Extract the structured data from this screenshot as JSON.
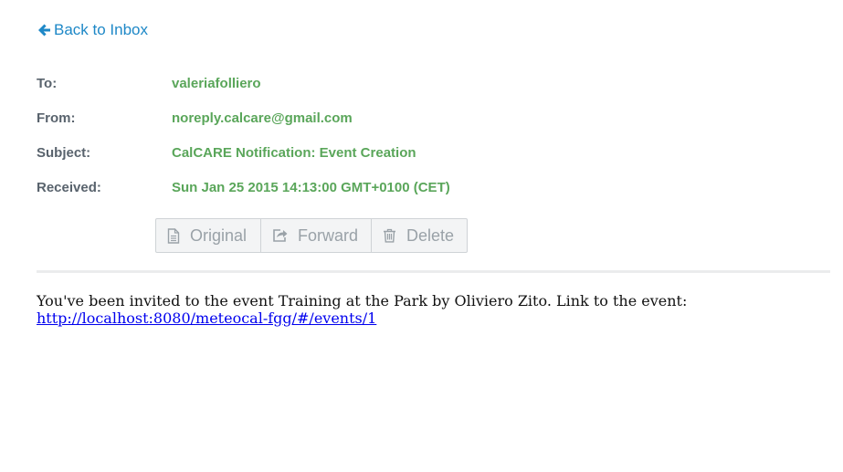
{
  "nav": {
    "back_label": "Back to Inbox",
    "back_icon": "arrow-left-icon",
    "accent_color": "#1e88c7"
  },
  "headers": {
    "to_label": "To:",
    "to_value": "valeriafolliero",
    "from_label": "From:",
    "from_value": "noreply.calcare@gmail.com",
    "subject_label": "Subject:",
    "subject_value": "CalCARE Notification: Event Creation",
    "received_label": "Received:",
    "received_value": "Sun Jan 25 2015 14:13:00 GMT+0100 (CET)",
    "label_color": "#59636d",
    "value_color": "#5aa65a"
  },
  "actions": {
    "original_label": "Original",
    "original_icon": "document-icon",
    "forward_label": "Forward",
    "forward_icon": "share-icon",
    "delete_label": "Delete",
    "delete_icon": "trash-icon"
  },
  "message": {
    "text": "You've been invited to the event Training at the Park by Oliviero Zito. Link to the event:",
    "link": "http://localhost:8080/meteocal-fgg/#/events/1"
  }
}
